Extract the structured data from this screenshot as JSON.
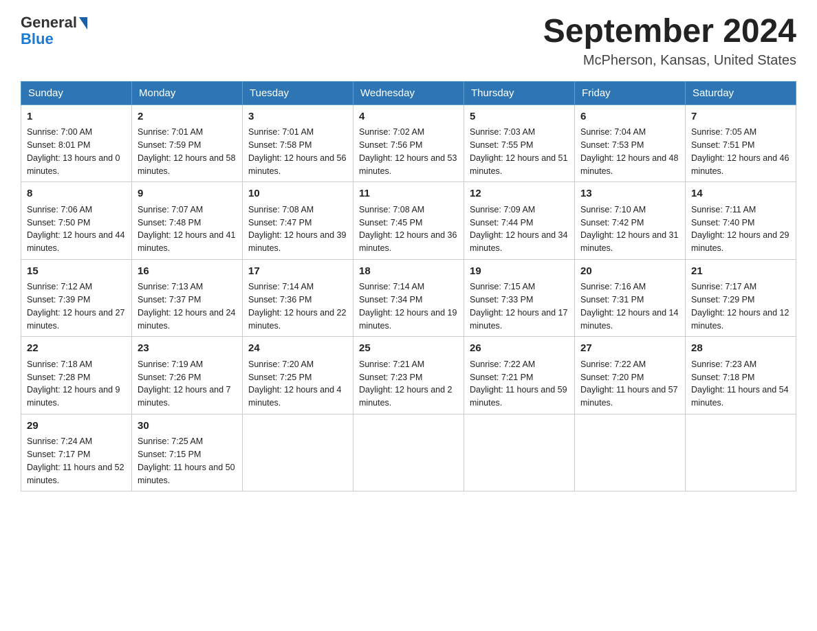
{
  "header": {
    "logo_text": "General",
    "logo_blue": "Blue",
    "month": "September 2024",
    "location": "McPherson, Kansas, United States"
  },
  "weekdays": [
    "Sunday",
    "Monday",
    "Tuesday",
    "Wednesday",
    "Thursday",
    "Friday",
    "Saturday"
  ],
  "weeks": [
    [
      {
        "day": "1",
        "sunrise": "7:00 AM",
        "sunset": "8:01 PM",
        "daylight": "13 hours and 0 minutes."
      },
      {
        "day": "2",
        "sunrise": "7:01 AM",
        "sunset": "7:59 PM",
        "daylight": "12 hours and 58 minutes."
      },
      {
        "day": "3",
        "sunrise": "7:01 AM",
        "sunset": "7:58 PM",
        "daylight": "12 hours and 56 minutes."
      },
      {
        "day": "4",
        "sunrise": "7:02 AM",
        "sunset": "7:56 PM",
        "daylight": "12 hours and 53 minutes."
      },
      {
        "day": "5",
        "sunrise": "7:03 AM",
        "sunset": "7:55 PM",
        "daylight": "12 hours and 51 minutes."
      },
      {
        "day": "6",
        "sunrise": "7:04 AM",
        "sunset": "7:53 PM",
        "daylight": "12 hours and 48 minutes."
      },
      {
        "day": "7",
        "sunrise": "7:05 AM",
        "sunset": "7:51 PM",
        "daylight": "12 hours and 46 minutes."
      }
    ],
    [
      {
        "day": "8",
        "sunrise": "7:06 AM",
        "sunset": "7:50 PM",
        "daylight": "12 hours and 44 minutes."
      },
      {
        "day": "9",
        "sunrise": "7:07 AM",
        "sunset": "7:48 PM",
        "daylight": "12 hours and 41 minutes."
      },
      {
        "day": "10",
        "sunrise": "7:08 AM",
        "sunset": "7:47 PM",
        "daylight": "12 hours and 39 minutes."
      },
      {
        "day": "11",
        "sunrise": "7:08 AM",
        "sunset": "7:45 PM",
        "daylight": "12 hours and 36 minutes."
      },
      {
        "day": "12",
        "sunrise": "7:09 AM",
        "sunset": "7:44 PM",
        "daylight": "12 hours and 34 minutes."
      },
      {
        "day": "13",
        "sunrise": "7:10 AM",
        "sunset": "7:42 PM",
        "daylight": "12 hours and 31 minutes."
      },
      {
        "day": "14",
        "sunrise": "7:11 AM",
        "sunset": "7:40 PM",
        "daylight": "12 hours and 29 minutes."
      }
    ],
    [
      {
        "day": "15",
        "sunrise": "7:12 AM",
        "sunset": "7:39 PM",
        "daylight": "12 hours and 27 minutes."
      },
      {
        "day": "16",
        "sunrise": "7:13 AM",
        "sunset": "7:37 PM",
        "daylight": "12 hours and 24 minutes."
      },
      {
        "day": "17",
        "sunrise": "7:14 AM",
        "sunset": "7:36 PM",
        "daylight": "12 hours and 22 minutes."
      },
      {
        "day": "18",
        "sunrise": "7:14 AM",
        "sunset": "7:34 PM",
        "daylight": "12 hours and 19 minutes."
      },
      {
        "day": "19",
        "sunrise": "7:15 AM",
        "sunset": "7:33 PM",
        "daylight": "12 hours and 17 minutes."
      },
      {
        "day": "20",
        "sunrise": "7:16 AM",
        "sunset": "7:31 PM",
        "daylight": "12 hours and 14 minutes."
      },
      {
        "day": "21",
        "sunrise": "7:17 AM",
        "sunset": "7:29 PM",
        "daylight": "12 hours and 12 minutes."
      }
    ],
    [
      {
        "day": "22",
        "sunrise": "7:18 AM",
        "sunset": "7:28 PM",
        "daylight": "12 hours and 9 minutes."
      },
      {
        "day": "23",
        "sunrise": "7:19 AM",
        "sunset": "7:26 PM",
        "daylight": "12 hours and 7 minutes."
      },
      {
        "day": "24",
        "sunrise": "7:20 AM",
        "sunset": "7:25 PM",
        "daylight": "12 hours and 4 minutes."
      },
      {
        "day": "25",
        "sunrise": "7:21 AM",
        "sunset": "7:23 PM",
        "daylight": "12 hours and 2 minutes."
      },
      {
        "day": "26",
        "sunrise": "7:22 AM",
        "sunset": "7:21 PM",
        "daylight": "11 hours and 59 minutes."
      },
      {
        "day": "27",
        "sunrise": "7:22 AM",
        "sunset": "7:20 PM",
        "daylight": "11 hours and 57 minutes."
      },
      {
        "day": "28",
        "sunrise": "7:23 AM",
        "sunset": "7:18 PM",
        "daylight": "11 hours and 54 minutes."
      }
    ],
    [
      {
        "day": "29",
        "sunrise": "7:24 AM",
        "sunset": "7:17 PM",
        "daylight": "11 hours and 52 minutes."
      },
      {
        "day": "30",
        "sunrise": "7:25 AM",
        "sunset": "7:15 PM",
        "daylight": "11 hours and 50 minutes."
      },
      null,
      null,
      null,
      null,
      null
    ]
  ]
}
